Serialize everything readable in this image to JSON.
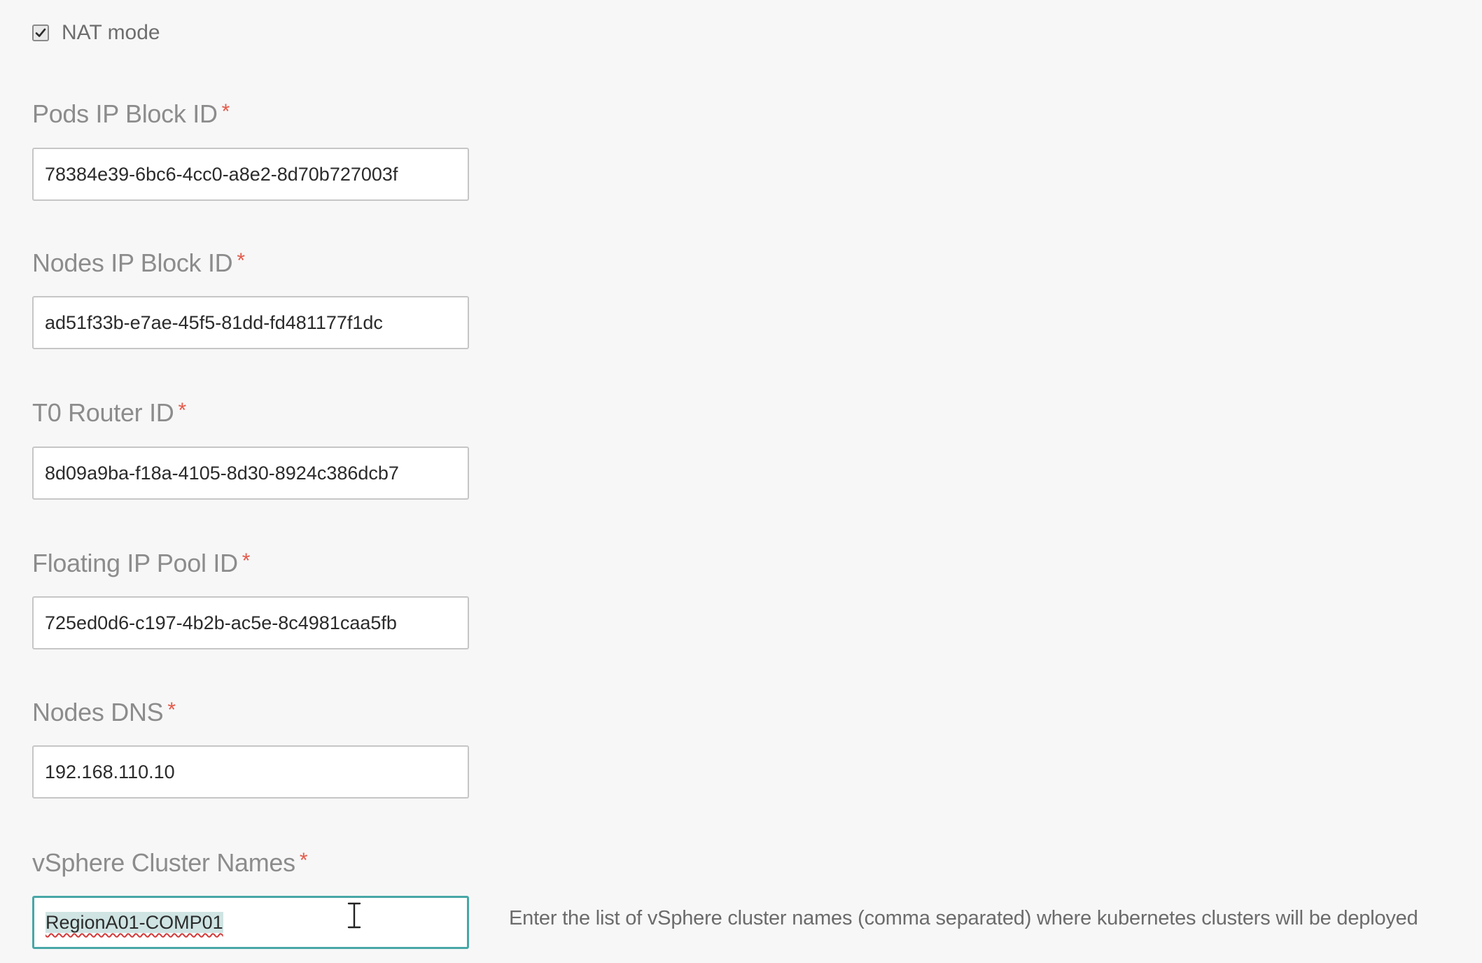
{
  "nat_mode": {
    "label": "NAT mode",
    "checked": true
  },
  "required_marker": "*",
  "fields": [
    {
      "label": "Pods IP Block ID",
      "value": "78384e39-6bc6-4cc0-a8e2-8d70b727003f"
    },
    {
      "label": "Nodes IP Block ID",
      "value": "ad51f33b-e7ae-45f5-81dd-fd481177f1dc"
    },
    {
      "label": "T0 Router ID",
      "value": "8d09a9ba-f18a-4105-8d30-8924c386dcb7"
    },
    {
      "label": "Floating IP Pool ID",
      "value": "725ed0d6-c197-4b2b-ac5e-8c4981caa5fb"
    },
    {
      "label": "Nodes DNS",
      "value": "192.168.110.10"
    },
    {
      "label": "vSphere Cluster Names",
      "value": "RegionA01-COMP01",
      "helper": "Enter the list of vSphere cluster names (comma separated) where kubernetes clusters will be deployed"
    }
  ],
  "colors": {
    "required": "#e35a4a",
    "focus_border": "#48a7a7",
    "selection": "#cfe4e3",
    "spellcheck": "#d23a3a"
  },
  "icons": {
    "checkbox": "checkmark-icon",
    "cursor": "text-cursor-icon"
  }
}
